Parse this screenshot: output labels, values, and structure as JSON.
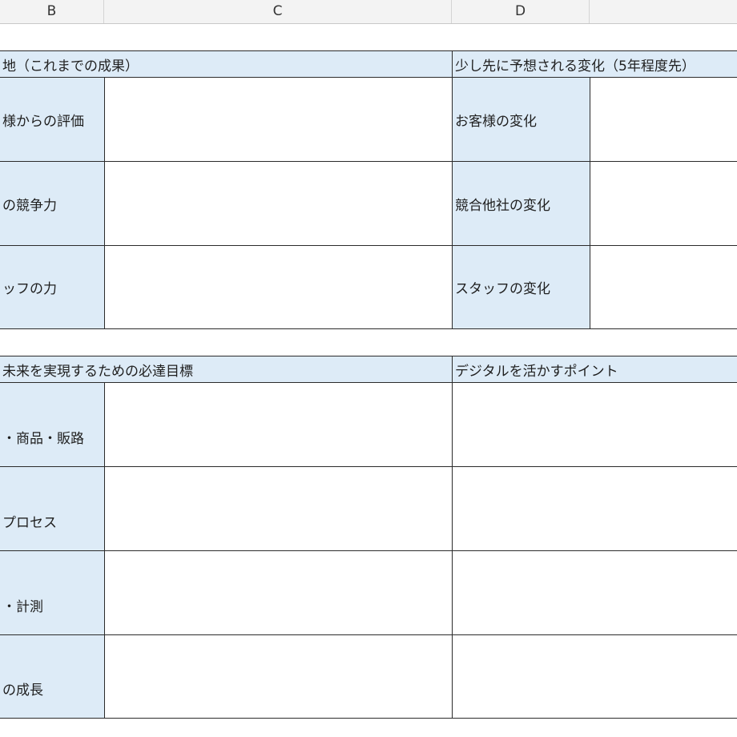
{
  "columns": [
    "B",
    "C",
    "D"
  ],
  "top_section": {
    "left_title": "地（これまでの成果）",
    "right_title": "少し先に予想される変化（5年程度先）",
    "left_labels": [
      "様からの評価",
      "の競争力",
      "ッフの力"
    ],
    "right_labels": [
      "お客様の変化",
      "競合他社の変化",
      "スタッフの変化"
    ]
  },
  "bottom_section": {
    "left_title": "未来を実現するための必達目標",
    "right_title": "デジタルを活かすポイント",
    "left_labels": [
      "・商品・販路",
      "プロセス",
      "・計測",
      "の成長"
    ]
  }
}
